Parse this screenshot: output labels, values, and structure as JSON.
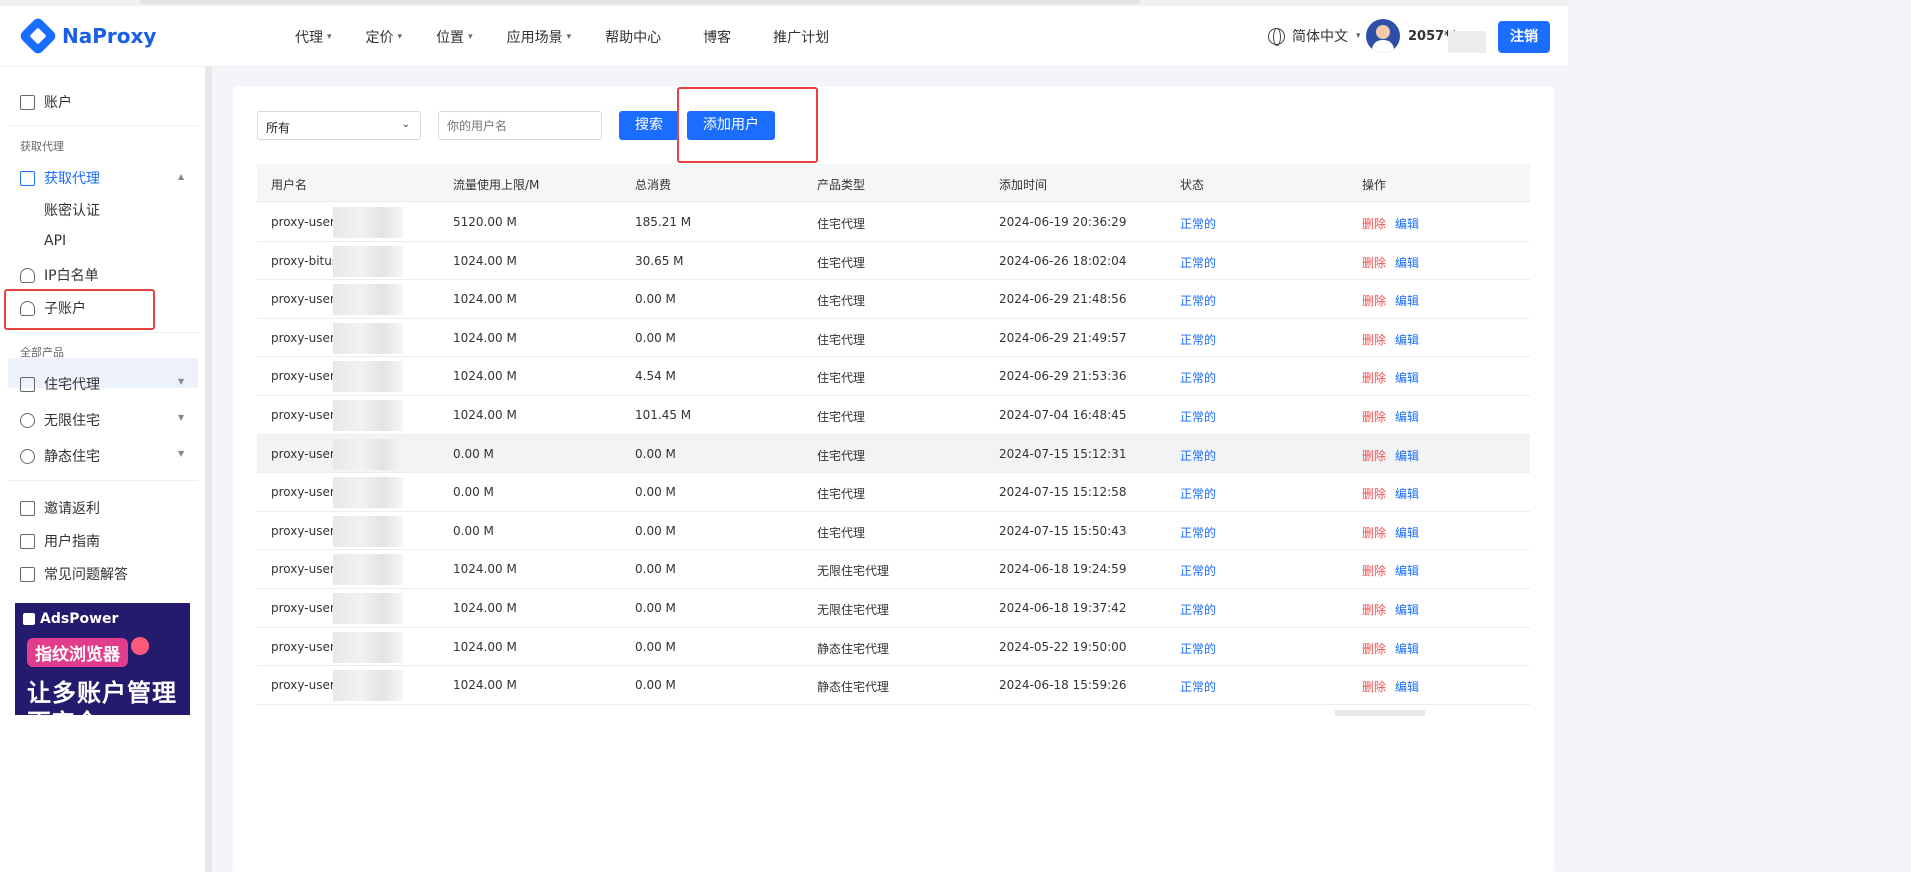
{
  "header": {
    "logo_text": "NaProxy",
    "nav": [
      "代理",
      "定价",
      "位置",
      "应用场景",
      "帮助中心",
      "博客",
      "推广计划"
    ],
    "nav_has_dropdown": [
      true,
      true,
      true,
      true,
      false,
      false,
      false
    ],
    "language": "简体中文",
    "user_id": "2057**",
    "logout_label": "注销"
  },
  "sidebar": {
    "account": "账户",
    "group_proxy": "获取代理",
    "get_proxy": "获取代理",
    "auth_pw": "账密认证",
    "api": "API",
    "ip_whitelist": "IP白名单",
    "sub_account": "子账户",
    "group_products": "全部产品",
    "residential": "住宅代理",
    "unlimited": "无限住宅",
    "static": "静态住宅",
    "invite": "邀请返利",
    "guide": "用户指南",
    "faq": "常见问题解答",
    "ad": {
      "brand": "AdsPower",
      "pill": "指纹浏览器",
      "line1": "让多账户管理",
      "line2": "更安全"
    }
  },
  "filters": {
    "select_value": "所有",
    "search_placeholder": "你的用户名",
    "search_label": "搜索",
    "add_user_label": "添加用户"
  },
  "table": {
    "columns": [
      "用户名",
      "流量使用上限/M",
      "总消费",
      "产品类型",
      "添加时间",
      "状态",
      "操作"
    ],
    "delete_label": "删除",
    "edit_label": "编辑",
    "rows": [
      {
        "username": "proxy-user",
        "limit": "5120.00 M",
        "spend": "185.21 M",
        "type": "住宅代理",
        "time": "2024-06-19 20:36:29",
        "status": "正常的"
      },
      {
        "username": "proxy-bitus",
        "limit": "1024.00 M",
        "spend": "30.65 M",
        "type": "住宅代理",
        "time": "2024-06-26 18:02:04",
        "status": "正常的"
      },
      {
        "username": "proxy-user",
        "limit": "1024.00 M",
        "spend": "0.00 M",
        "type": "住宅代理",
        "time": "2024-06-29 21:48:56",
        "status": "正常的"
      },
      {
        "username": "proxy-user",
        "limit": "1024.00 M",
        "spend": "0.00 M",
        "type": "住宅代理",
        "time": "2024-06-29 21:49:57",
        "status": "正常的"
      },
      {
        "username": "proxy-user",
        "limit": "1024.00 M",
        "spend": "4.54 M",
        "type": "住宅代理",
        "time": "2024-06-29 21:53:36",
        "status": "正常的"
      },
      {
        "username": "proxy-user",
        "limit": "1024.00 M",
        "spend": "101.45 M",
        "type": "住宅代理",
        "time": "2024-07-04 16:48:45",
        "status": "正常的"
      },
      {
        "username": "proxy-user",
        "limit": "0.00 M",
        "spend": "0.00 M",
        "type": "住宅代理",
        "time": "2024-07-15 15:12:31",
        "status": "正常的"
      },
      {
        "username": "proxy-user",
        "limit": "0.00 M",
        "spend": "0.00 M",
        "type": "住宅代理",
        "time": "2024-07-15 15:12:58",
        "status": "正常的"
      },
      {
        "username": "proxy-user",
        "limit": "0.00 M",
        "spend": "0.00 M",
        "type": "住宅代理",
        "time": "2024-07-15 15:50:43",
        "status": "正常的"
      },
      {
        "username": "proxy-user",
        "limit": "1024.00 M",
        "spend": "0.00 M",
        "type": "无限住宅代理",
        "time": "2024-06-18 19:24:59",
        "status": "正常的"
      },
      {
        "username": "proxy-user",
        "limit": "1024.00 M",
        "spend": "0.00 M",
        "type": "无限住宅代理",
        "time": "2024-06-18 19:37:42",
        "status": "正常的"
      },
      {
        "username": "proxy-user",
        "limit": "1024.00 M",
        "spend": "0.00 M",
        "type": "静态住宅代理",
        "time": "2024-05-22 19:50:00",
        "status": "正常的"
      },
      {
        "username": "proxy-user",
        "limit": "1024.00 M",
        "spend": "0.00 M",
        "type": "静态住宅代理",
        "time": "2024-06-18 15:59:26",
        "status": "正常的"
      }
    ]
  },
  "colors": {
    "primary": "#1a6dff",
    "danger": "#f05050",
    "highlight": "#e8413f"
  }
}
